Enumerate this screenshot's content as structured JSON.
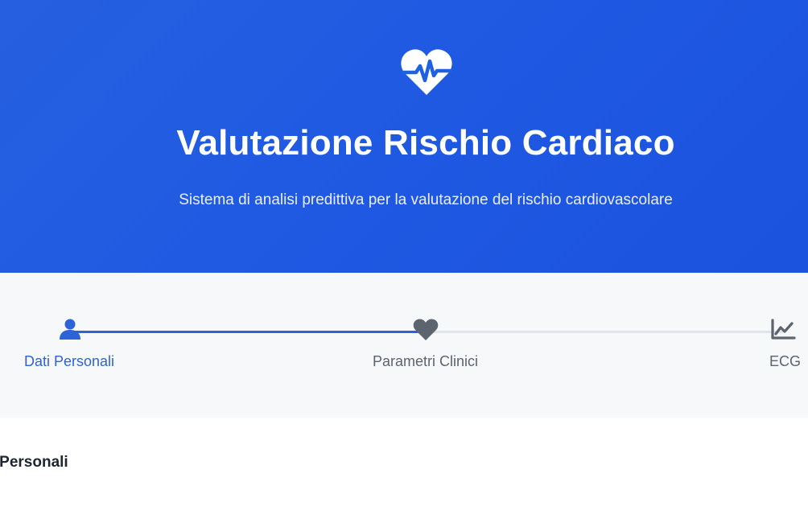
{
  "header": {
    "title": "Valutazione Rischio Cardiaco",
    "subtitle": "Sistema di analisi predittiva per la valutazione del rischio cardiovascolare",
    "icon": "heart-pulse-icon"
  },
  "stepper": {
    "steps": [
      {
        "label": "Dati Personali",
        "icon": "user-icon",
        "state": "active"
      },
      {
        "label": "Parametri Clinici",
        "icon": "heart-icon",
        "state": "pending"
      },
      {
        "label": "ECG",
        "icon": "chart-line-icon",
        "state": "pending"
      }
    ]
  },
  "form": {
    "section_title": "Dati Personali"
  },
  "colors": {
    "primary": "#2d63d8",
    "header_bg": "#1f59e2",
    "stepper_bg": "#f7f8fa",
    "inactive": "#5c6470"
  }
}
